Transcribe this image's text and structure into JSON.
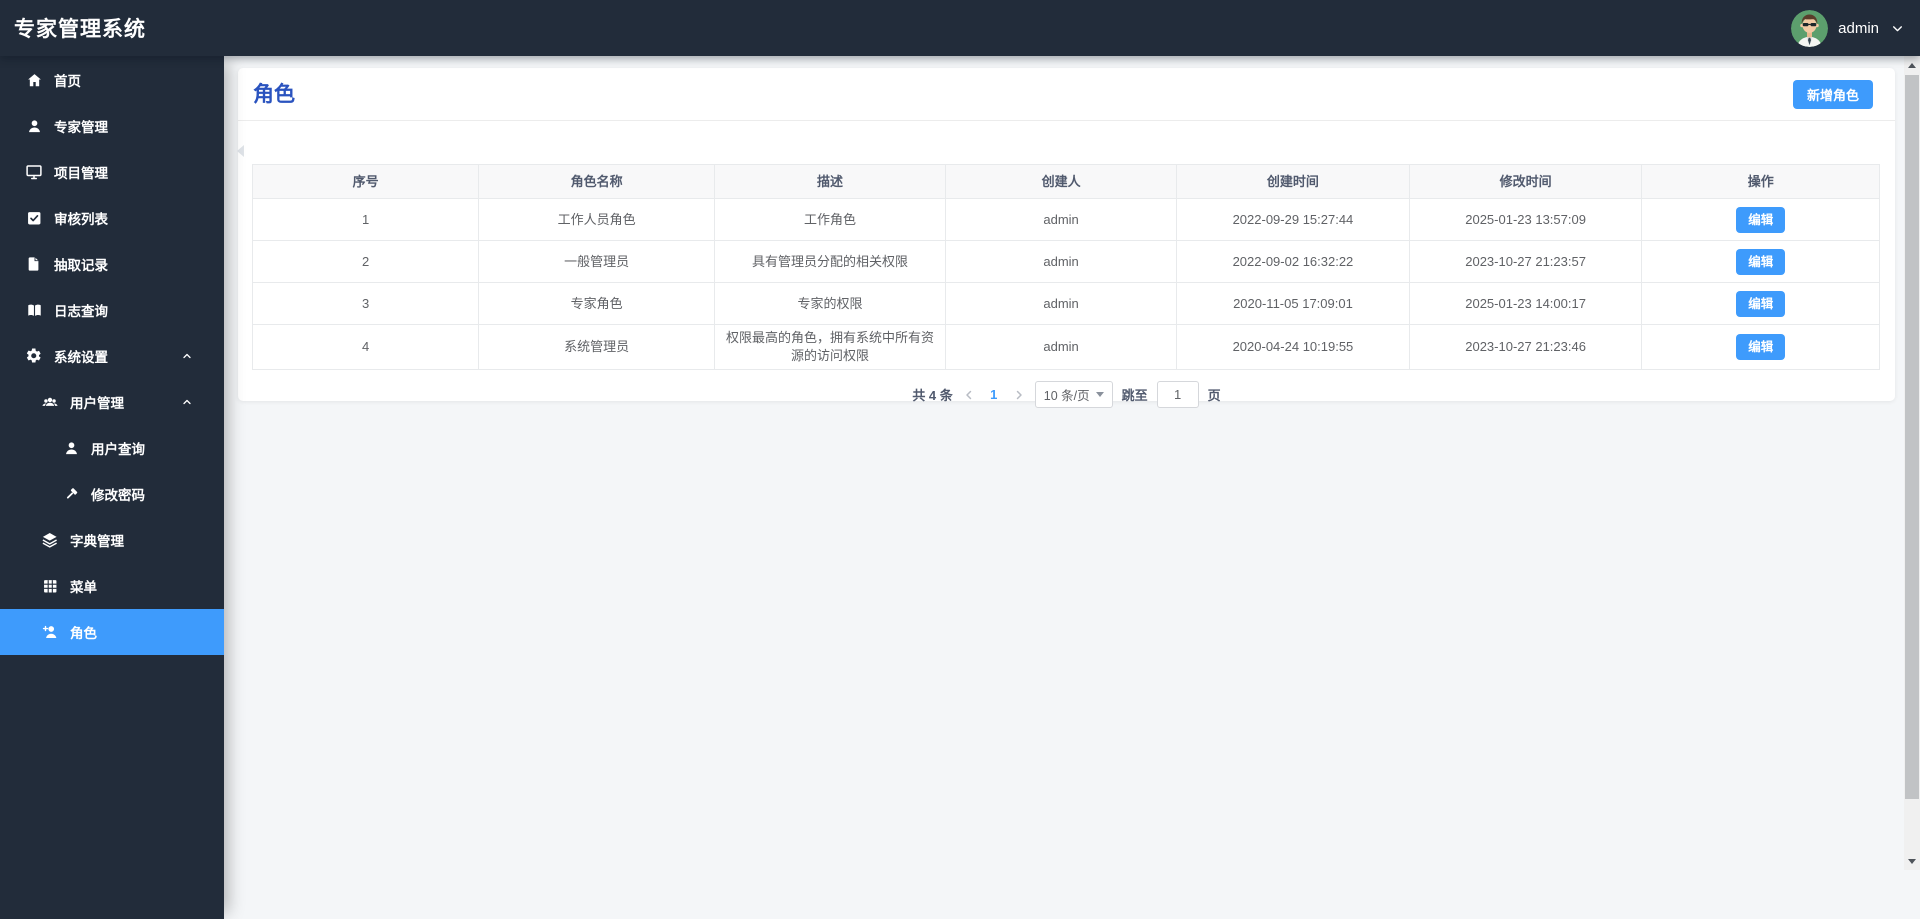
{
  "app": {
    "title": "专家管理系统"
  },
  "header": {
    "username": "admin",
    "avatar": "cartoon-man-sunglasses-green"
  },
  "colors": {
    "accent_blue": "#3e9bfc",
    "title_blue": "#2a53bf",
    "dark_navy": "#222c3a",
    "avatar_green": "#5c9f6d"
  },
  "sidebar": {
    "items": [
      {
        "id": "home",
        "label": "首页",
        "icon": "home-icon",
        "level": 1,
        "active": false,
        "expanded": null
      },
      {
        "id": "expert-mgmt",
        "label": "专家管理",
        "icon": "user-icon",
        "level": 1,
        "active": false,
        "expanded": null
      },
      {
        "id": "project-mgmt",
        "label": "项目管理",
        "icon": "monitor-icon",
        "level": 1,
        "active": false,
        "expanded": null
      },
      {
        "id": "audit-list",
        "label": "审核列表",
        "icon": "check-square-icon",
        "level": 1,
        "active": false,
        "expanded": null
      },
      {
        "id": "draw-records",
        "label": "抽取记录",
        "icon": "file-icon",
        "level": 1,
        "active": false,
        "expanded": null
      },
      {
        "id": "log-query",
        "label": "日志查询",
        "icon": "book-icon",
        "level": 1,
        "active": false,
        "expanded": null
      },
      {
        "id": "system-settings",
        "label": "系统设置",
        "icon": "gear-icon",
        "level": 1,
        "active": false,
        "expanded": true
      },
      {
        "id": "user-mgmt",
        "label": "用户管理",
        "icon": "users-icon",
        "level": 2,
        "active": false,
        "expanded": true
      },
      {
        "id": "user-query",
        "label": "用户查询",
        "icon": "user-icon",
        "level": 3,
        "active": false,
        "expanded": null
      },
      {
        "id": "change-password",
        "label": "修改密码",
        "icon": "hammer-icon",
        "level": 3,
        "active": false,
        "expanded": null
      },
      {
        "id": "dict-mgmt",
        "label": "字典管理",
        "icon": "layers-icon",
        "level": 2,
        "active": false,
        "expanded": null
      },
      {
        "id": "menu",
        "label": "菜单",
        "icon": "grid-icon",
        "level": 2,
        "active": false,
        "expanded": null
      },
      {
        "id": "role",
        "label": "角色",
        "icon": "user-plus-icon",
        "level": 2,
        "active": true,
        "expanded": null
      }
    ]
  },
  "page": {
    "title": "角色",
    "add_button_label": "新增角色"
  },
  "table": {
    "columns": [
      "序号",
      "角色名称",
      "描述",
      "创建人",
      "创建时间",
      "修改时间",
      "操作"
    ],
    "edit_label": "编辑",
    "rows": [
      {
        "no": "1",
        "name": "工作人员角色",
        "desc": "工作角色",
        "creator": "admin",
        "created": "2022-09-29 15:27:44",
        "modified": "2025-01-23 13:57:09"
      },
      {
        "no": "2",
        "name": "一般管理员",
        "desc": "具有管理员分配的相关权限",
        "creator": "admin",
        "created": "2022-09-02 16:32:22",
        "modified": "2023-10-27 21:23:57"
      },
      {
        "no": "3",
        "name": "专家角色",
        "desc": "专家的权限",
        "creator": "admin",
        "created": "2020-11-05 17:09:01",
        "modified": "2025-01-23 14:00:17"
      },
      {
        "no": "4",
        "name": "系统管理员",
        "desc": "权限最高的角色，拥有系统中所有资源的访问权限",
        "creator": "admin",
        "created": "2020-04-24 10:19:55",
        "modified": "2023-10-27 21:23:46"
      }
    ]
  },
  "pagination": {
    "total_label": "共 4 条",
    "current_page": "1",
    "page_size_label": "10 条/页",
    "jump_prefix": "跳至",
    "jump_value": "1",
    "jump_suffix": "页"
  }
}
